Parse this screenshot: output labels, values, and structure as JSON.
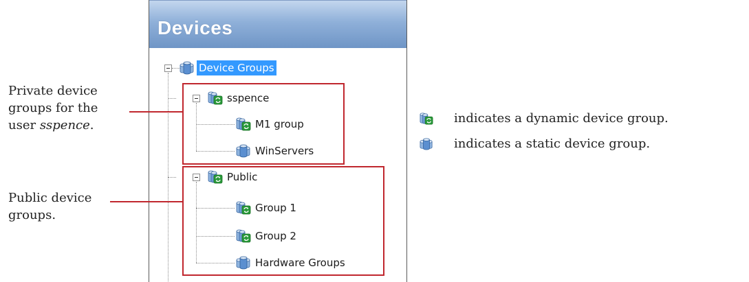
{
  "panel": {
    "title": "Devices"
  },
  "tree": {
    "root": {
      "label": "Device Groups",
      "icon": "static-group-icon",
      "selected": true
    },
    "private_group": {
      "label": "sspence",
      "icon": "dynamic-group-icon",
      "children": [
        {
          "label": "M1 group",
          "icon": "dynamic-group-icon"
        },
        {
          "label": "WinServers",
          "icon": "static-group-icon"
        }
      ]
    },
    "public_group": {
      "label": "Public",
      "icon": "dynamic-group-icon",
      "children": [
        {
          "label": "Group 1",
          "icon": "dynamic-group-icon"
        },
        {
          "label": "Group 2",
          "icon": "dynamic-group-icon"
        },
        {
          "label": "Hardware Groups",
          "icon": "static-group-icon"
        }
      ]
    }
  },
  "annotations": {
    "private": {
      "line1": "Private device",
      "line2": "groups for the",
      "line3_prefix": "user ",
      "line3_user": "sspence",
      "line3_suffix": "."
    },
    "public": {
      "line1": "Public device",
      "line2": "groups."
    }
  },
  "legend": {
    "dynamic": {
      "icon": "dynamic-group-icon",
      "text": "indicates a dynamic device group."
    },
    "static": {
      "icon": "static-group-icon",
      "text": "indicates a static device group."
    }
  },
  "colors": {
    "header_gradient_top": "#c3d6ee",
    "header_gradient_bottom": "#6f95c6",
    "selection": "#3399ff",
    "callout_red": "#c0262d",
    "static_icon_blue": "#5b8fd0",
    "dynamic_icon_green": "#2a9a3a"
  }
}
